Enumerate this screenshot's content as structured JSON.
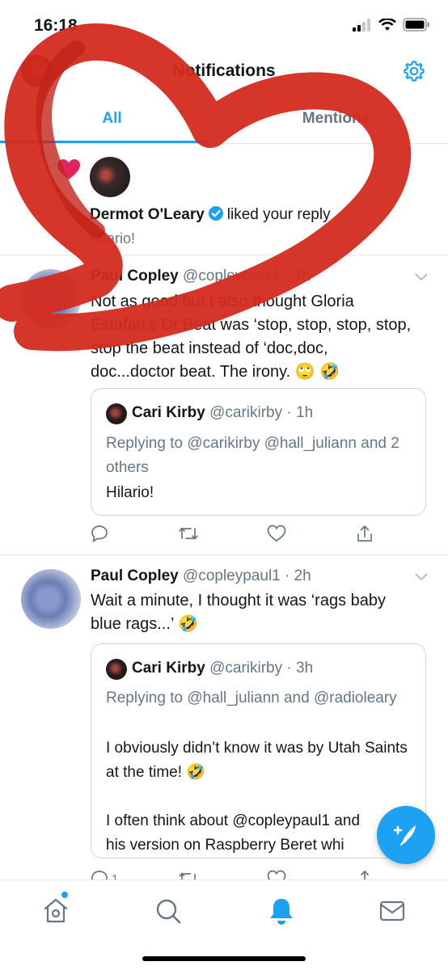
{
  "status_bar": {
    "time": "16:18"
  },
  "header": {
    "title": "Notifications"
  },
  "tabs": {
    "all": "All",
    "mentions": "Mentions"
  },
  "like_notification": {
    "user_name": "Dermot O'Leary",
    "action": "liked your reply",
    "reply_text": "Hilario!"
  },
  "tweets": [
    {
      "name": "Paul Copley",
      "handle_time": "@copleypaul1 · 1h",
      "body": "Not as good but I also thought Gloria Estafan's Dr Beat was ‘stop, stop, stop, stop, stop the beat instead of ‘doc,doc, doc...doctor beat. The irony. 🙄 🤣",
      "quote": {
        "name": "Cari Kirby",
        "handle_time": "@carikirby · 1h",
        "replying": "Replying to @carikirby @hall_juliann and 2 others",
        "text": "Hilario!"
      }
    },
    {
      "name": "Paul Copley",
      "handle_time": "@copleypaul1 · 2h",
      "body": "Wait a minute, I thought it was ‘rags baby blue rags...’ 🤣",
      "quote": {
        "name": "Cari Kirby",
        "handle_time": "@carikirby · 3h",
        "replying": "Replying to @hall_juliann and @radioleary",
        "text1": "I obviously didn’t know it was by Utah Saints at the time! 🤣",
        "text2": "I often think about @copleypaul1 and his version on Raspberry Beret whi"
      },
      "reply_count": "1"
    }
  ],
  "colors": {
    "accent": "#1da1f2",
    "like": "#e0245e",
    "scribble": "#d42a1e",
    "muted": "#657786"
  },
  "icons": [
    "settings-gear-icon",
    "heart-icon",
    "verified-badge-icon",
    "chevron-down-icon",
    "reply-icon",
    "retweet-icon",
    "like-icon",
    "share-icon",
    "compose-icon",
    "home-icon",
    "search-icon",
    "notifications-bell-icon",
    "messages-mail-icon"
  ]
}
